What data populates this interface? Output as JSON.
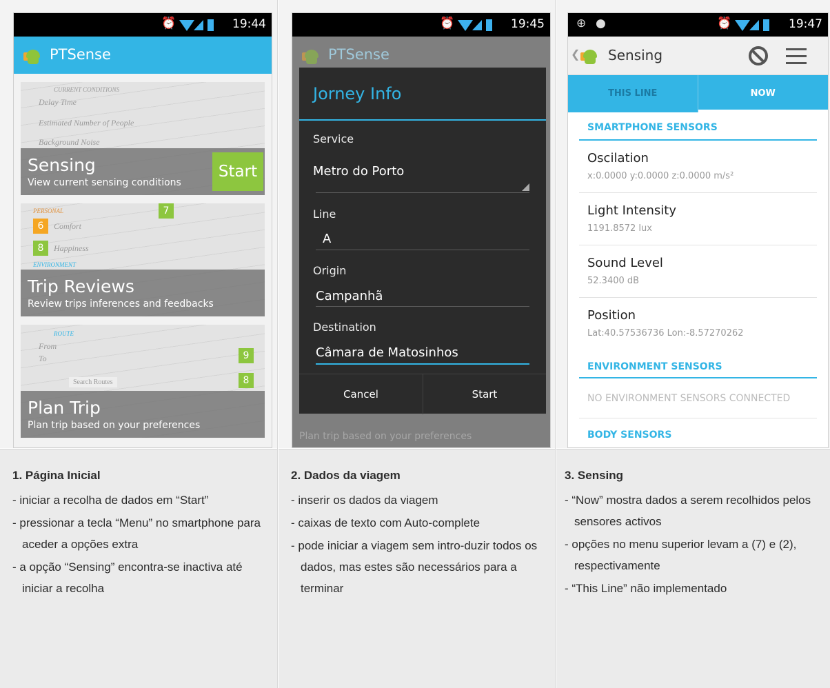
{
  "status": {
    "s1_time": "19:44",
    "s2_time": "19:45",
    "s3_time": "19:47"
  },
  "home": {
    "app_name": "PTSense",
    "tiles": [
      {
        "title": "Sensing",
        "subtitle": "View current sensing conditions",
        "button": "Start",
        "mock": [
          "CURRENT CONDITIONS",
          "Delay Time",
          "Estimated Number of People",
          "Background Noise"
        ]
      },
      {
        "title": "Trip Reviews",
        "subtitle": "Review trips inferences and feedbacks",
        "mock": [
          "PERSONAL",
          "Comfort",
          "Happiness",
          "ENVIRONMENT"
        ],
        "badges": [
          "6",
          "8",
          "7"
        ]
      },
      {
        "title": "Plan Trip",
        "subtitle": "Plan trip based on your preferences",
        "mock": [
          "ROUTE",
          "From",
          "To",
          "Search Routes"
        ],
        "badges": [
          "9",
          "8"
        ]
      }
    ]
  },
  "journey_dialog": {
    "background_app_name": "PTSense",
    "background_hint": "Plan trip based on your preferences",
    "title": "Jorney Info",
    "fields": [
      {
        "label": "Service",
        "value": "Metro do Porto"
      },
      {
        "label": "Line",
        "value": "A"
      },
      {
        "label": "Origin",
        "value": "Campanhã"
      },
      {
        "label": "Destination",
        "value": "Câmara de Matosinhos"
      }
    ],
    "cancel": "Cancel",
    "start": "Start"
  },
  "sensing": {
    "title": "Sensing",
    "tabs": [
      "THIS LINE",
      "NOW"
    ],
    "sections": {
      "smartphone": "SMARTPHONE SENSORS",
      "environment": "ENVIRONMENT SENSORS",
      "body": "BODY SENSORS"
    },
    "rows": [
      {
        "title": "Oscilation",
        "value": "x:0.0000 y:0.0000 z:0.0000 m/s²"
      },
      {
        "title": "Light Intensity",
        "value": "1191.8572 lux"
      },
      {
        "title": "Sound Level",
        "value": "52.3400 dB"
      },
      {
        "title": "Position",
        "value": "Lat:40.57536736 Lon:-8.57270262"
      }
    ],
    "empty_environment": "NO ENVIRONMENT SENSORS CONNECTED"
  },
  "captions": [
    {
      "title": "1. Página Inicial",
      "items": [
        "- iniciar a recolha de dados em “Start”",
        "- pressionar a tecla “Menu” no smartphone para aceder a opções extra",
        "- a opção “Sensing” encontra-se inactiva até iniciar a recolha"
      ]
    },
    {
      "title": "2. Dados da viagem",
      "items": [
        "- inserir os dados da viagem",
        "- caixas de texto com Auto-complete",
        "- pode iniciar a viagem sem intro-duzir todos os dados, mas estes são necessários para a terminar"
      ]
    },
    {
      "title": "3. Sensing",
      "items": [
        "- “Now” mostra dados a serem recolhidos pelos sensores activos",
        "- opções no menu superior levam a (7) e (2), respectivamente",
        "- “This Line” não implementado"
      ]
    }
  ],
  "colors": {
    "accent": "#33b5e5",
    "start_green": "#8dc63f",
    "dialog_bg": "#2b2b2b"
  }
}
